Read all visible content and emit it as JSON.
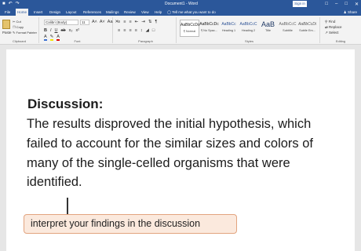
{
  "titlebar": {
    "qat_icons": [
      "save-icon",
      "undo-icon",
      "redo-icon"
    ],
    "document_title": "Document1 - Word",
    "signin_label": "Sign in",
    "controls": [
      "minimize-icon",
      "restore-icon",
      "close-icon"
    ]
  },
  "tabs": [
    {
      "label": "File",
      "active": false
    },
    {
      "label": "Home",
      "active": true
    },
    {
      "label": "Insert",
      "active": false
    },
    {
      "label": "Design",
      "active": false
    },
    {
      "label": "Layout",
      "active": false
    },
    {
      "label": "References",
      "active": false
    },
    {
      "label": "Mailings",
      "active": false
    },
    {
      "label": "Review",
      "active": false
    },
    {
      "label": "View",
      "active": false
    },
    {
      "label": "Help",
      "active": false
    }
  ],
  "tell_me": "Tell me what you want to do",
  "share_label": "Share",
  "ribbon": {
    "clipboard": {
      "paste_label": "Paste",
      "cut_label": "Cut",
      "copy_label": "Copy",
      "format_painter_label": "Format Painter",
      "group_label": "Clipboard"
    },
    "font": {
      "font_name": "Calibri (Body)",
      "font_size": "11",
      "group_label": "Font"
    },
    "paragraph": {
      "group_label": "Paragraph"
    },
    "styles": {
      "items": [
        {
          "preview": "AaBbCcDc",
          "name": "¶ Normal",
          "selected": true
        },
        {
          "preview": "AaBbCcDc",
          "name": "¶ No Spac...",
          "selected": false
        },
        {
          "preview": "AaBbCc",
          "name": "Heading 1",
          "selected": false
        },
        {
          "preview": "AaBbCcC",
          "name": "Heading 2",
          "selected": false
        },
        {
          "preview": "AaB",
          "name": "Title",
          "selected": false
        },
        {
          "preview": "AaBbCcC",
          "name": "Subtitle",
          "selected": false
        },
        {
          "preview": "AaBbCcDi",
          "name": "Subtle Em...",
          "selected": false
        }
      ],
      "group_label": "Styles"
    },
    "editing": {
      "find_label": "Find",
      "replace_label": "Replace",
      "select_label": "Select",
      "group_label": "Editing"
    }
  },
  "document": {
    "heading": "Discussion:",
    "lines": [
      "The results disproved the initial hypothesis, which",
      "failed to account for the similar sizes and colors of",
      "many of the single-celled organisms that were",
      "identified."
    ]
  },
  "callout": "interpret your findings in the discussion"
}
